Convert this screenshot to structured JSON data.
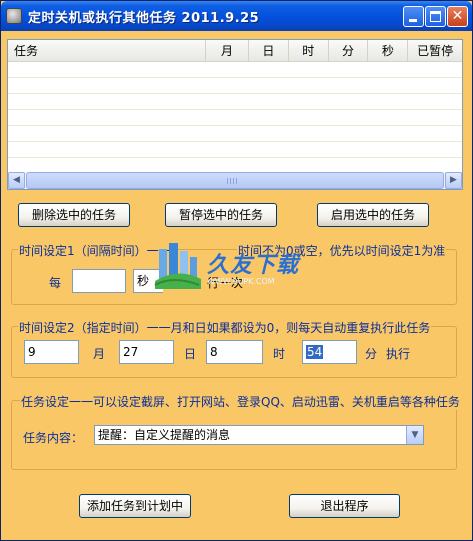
{
  "window": {
    "title": "定时关机或执行其他任务  2011.9.25",
    "minimize_label": "",
    "maximize_label": "",
    "close_label": "✕"
  },
  "tasklist": {
    "columns": [
      "任务",
      "月",
      "日",
      "时",
      "分",
      "秒",
      "已暂停"
    ],
    "scroll_left": "◀",
    "scroll_right": "▶"
  },
  "actions": {
    "delete": "删除选中的任务",
    "pause": "暂停选中的任务",
    "enable": "启用选中的任务"
  },
  "interval": {
    "group_label": "时间设定1（间隔时间）一一",
    "note": "时间不为0或空，优先以时间设定1为准",
    "every_label": "每",
    "value": "",
    "unit_partial": "秒",
    "exec_partial": "行一次"
  },
  "fixed": {
    "group_label": "时间设定2（指定时间）一一月和日如果都设为0，则每天自动重复执行此任务",
    "month_value": "9",
    "month_label": "月",
    "day_value": "27",
    "day_label": "日",
    "hour_value": "8",
    "hour_label": "时",
    "minute_value": "54",
    "minute_label": "分",
    "exec_label": "执行"
  },
  "task": {
    "group_label": "任务设定一一可以设定截屏、打开网站、登录QQ、启动迅雷、关机重启等各种任务",
    "content_label": "任务内容：",
    "selected": "提醒：自定义提醒的消息",
    "dropdown_glyph": "▼"
  },
  "footer": {
    "add": "添加任务到计划中",
    "exit": "退出程序"
  },
  "watermark": {
    "brand": "久友下载",
    "site": "WWW.9UPK.COM"
  }
}
